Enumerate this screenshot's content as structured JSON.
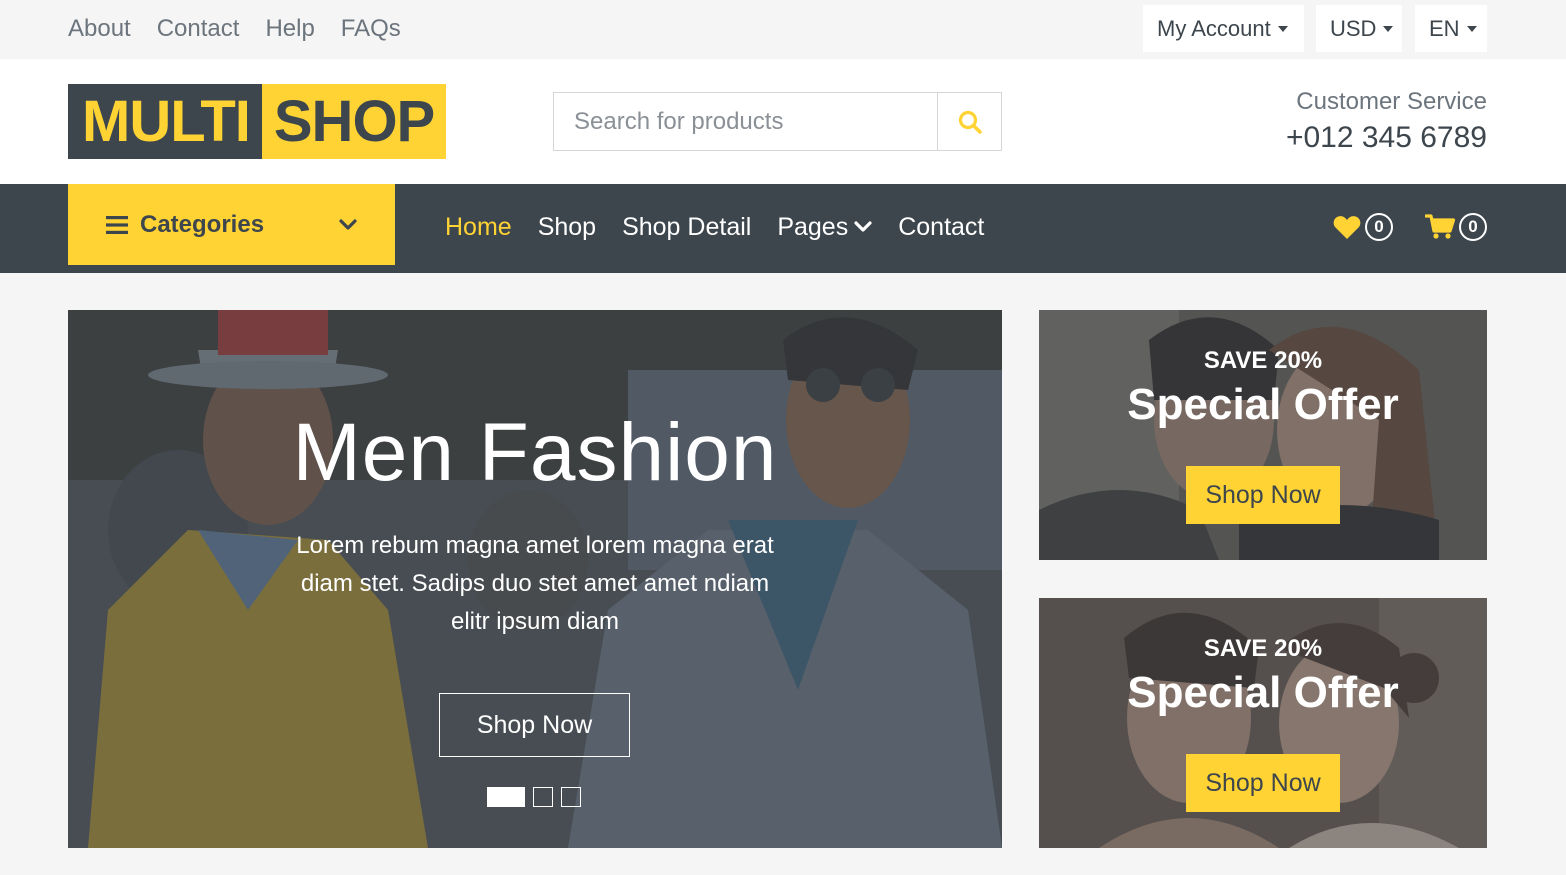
{
  "topbar": {
    "links": [
      "About",
      "Contact",
      "Help",
      "FAQs"
    ],
    "account_label": "My Account",
    "currency_label": "USD",
    "language_label": "EN"
  },
  "header": {
    "logo_part1": "MULTI",
    "logo_part2": "SHOP",
    "search_placeholder": "Search for products",
    "customer_service_label": "Customer Service",
    "customer_service_phone": "+012 345 6789"
  },
  "navbar": {
    "categories_label": "Categories",
    "links": [
      "Home",
      "Shop",
      "Shop Detail",
      "Pages",
      "Contact"
    ],
    "active_link": "Home",
    "wishlist_count": "0",
    "cart_count": "0"
  },
  "carousel": {
    "title": "Men Fashion",
    "text": "Lorem rebum magna amet lorem magna erat diam stet. Sadips duo stet amet amet ndiam elitr ipsum diam",
    "button_label": "Shop Now",
    "slide_count": 3,
    "active_slide": 1
  },
  "offers": [
    {
      "save_label": "SAVE 20%",
      "title": "Special Offer",
      "button_label": "Shop Now"
    },
    {
      "save_label": "SAVE 20%",
      "title": "Special Offer",
      "button_label": "Shop Now"
    }
  ],
  "colors": {
    "primary": "#ffd333",
    "dark": "#3d464d",
    "light": "#f5f5f5"
  },
  "icons": {
    "search": "search-icon",
    "categories": "bars-icon",
    "categories_toggle": "chevron-down-icon",
    "wishlist": "heart-icon",
    "cart": "shopping-cart-icon"
  }
}
